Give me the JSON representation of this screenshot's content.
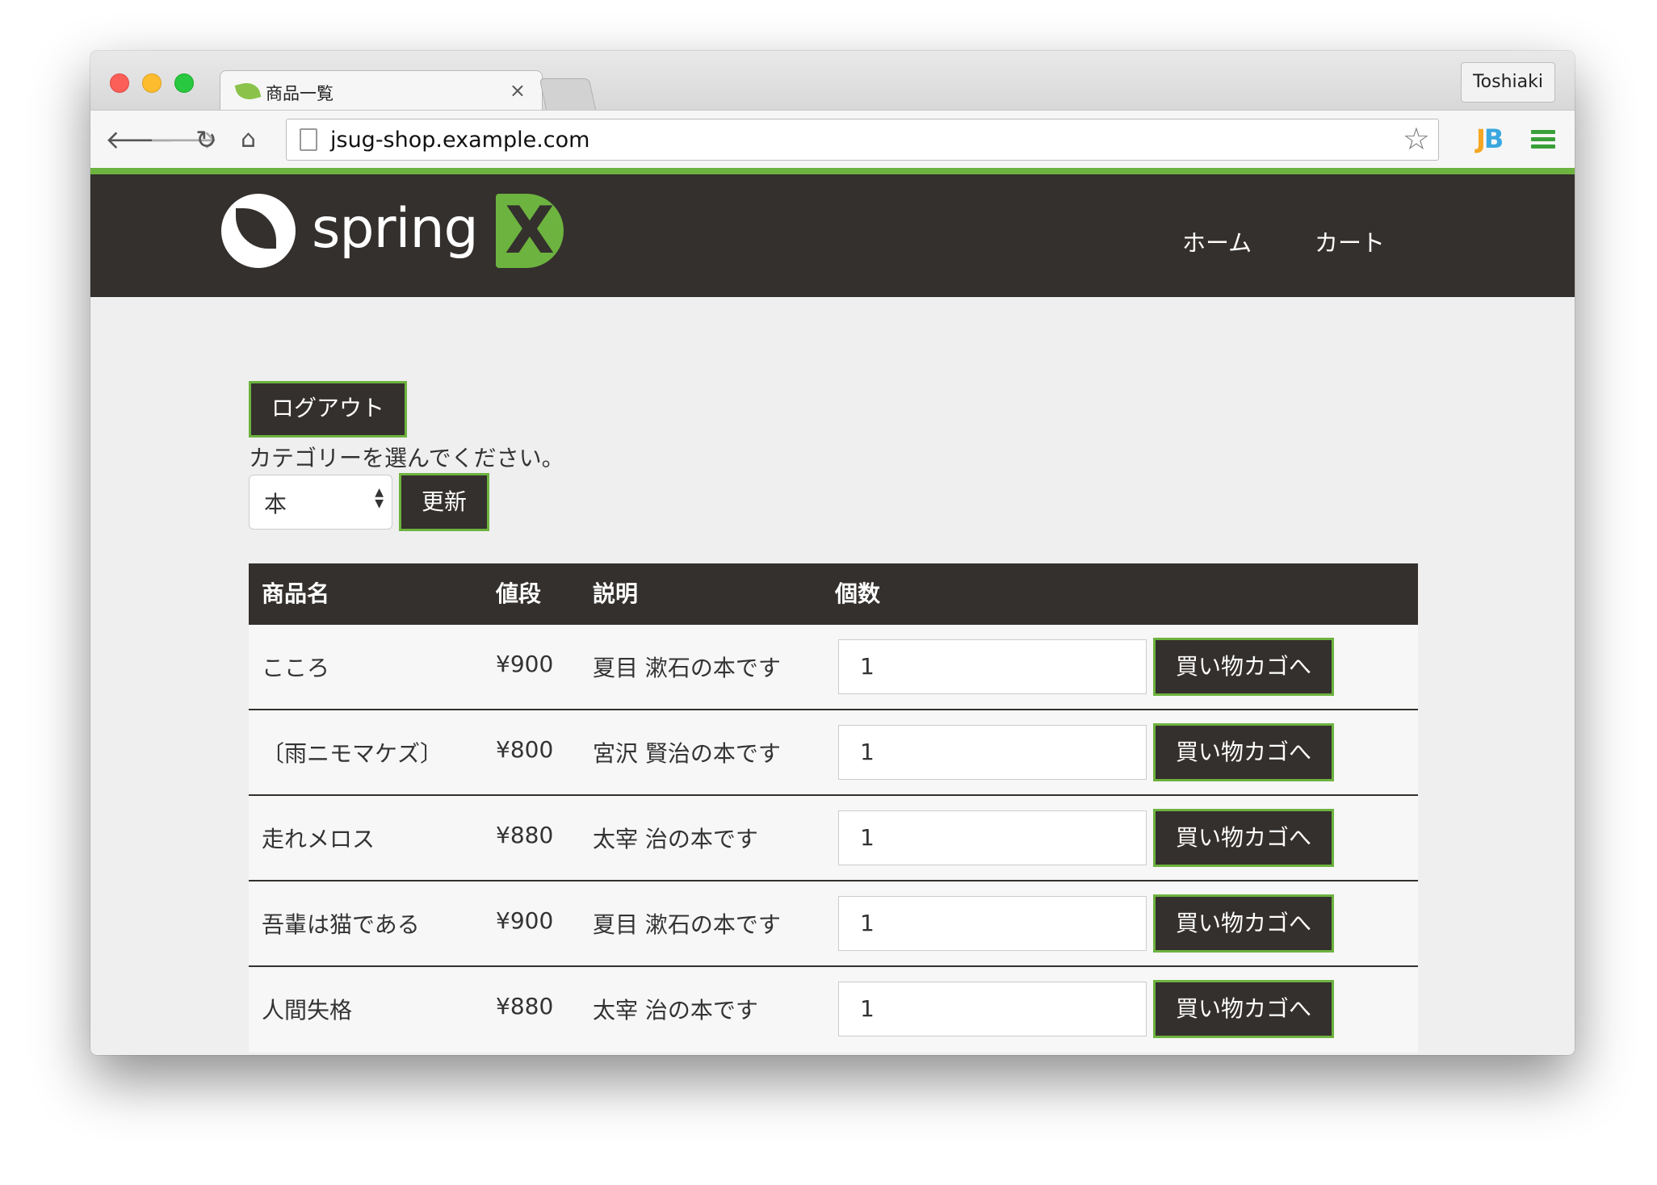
{
  "browser": {
    "tab_title": "商品一覧",
    "tab_close": "×",
    "profile_name": "Toshiaki",
    "url": "jsug-shop.example.com",
    "icons": [
      "back-icon",
      "forward-icon",
      "reload-icon",
      "home-icon",
      "page-icon",
      "star-icon",
      "jb-extension-icon",
      "menu-icon",
      "spring-favicon"
    ],
    "nav_glyphs": {
      "back": "🡐",
      "forward": "🡒",
      "reload": "↻",
      "home": "⌂",
      "star": "☆"
    },
    "ext_label_a": "J",
    "ext_label_b": "B"
  },
  "site": {
    "logo_text": "spring",
    "accent_color": "#6db33f",
    "header_color": "#34302d",
    "nav": {
      "home": "ホーム",
      "cart": "カート"
    }
  },
  "main": {
    "logout_label": "ログアウト",
    "category_prompt": "カテゴリーを選んでください。",
    "category_selected": "本",
    "update_label": "更新"
  },
  "table": {
    "headers": {
      "name": "商品名",
      "price": "値段",
      "description": "説明",
      "quantity": "個数"
    },
    "add_to_cart_label": "買い物カゴへ",
    "rows": [
      {
        "name": "こころ",
        "price": "¥900",
        "description": "夏目 漱石の本です",
        "quantity": "1"
      },
      {
        "name": "〔雨ニモマケズ〕",
        "price": "¥800",
        "description": "宮沢 賢治の本です",
        "quantity": "1"
      },
      {
        "name": "走れメロス",
        "price": "¥880",
        "description": "太宰 治の本です",
        "quantity": "1"
      },
      {
        "name": "吾輩は猫である",
        "price": "¥900",
        "description": "夏目 漱石の本です",
        "quantity": "1"
      },
      {
        "name": "人間失格",
        "price": "¥880",
        "description": "太宰 治の本です",
        "quantity": "1"
      }
    ]
  }
}
